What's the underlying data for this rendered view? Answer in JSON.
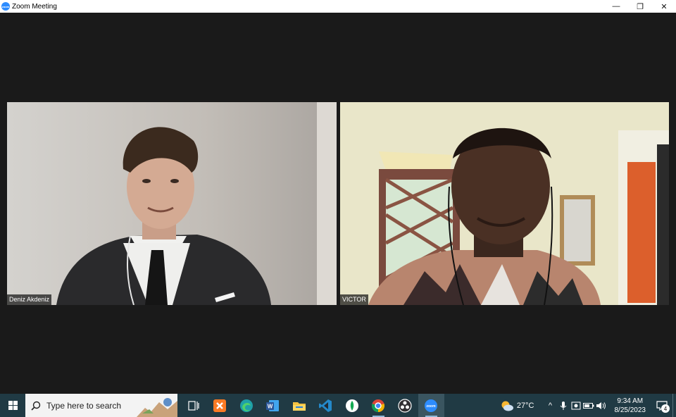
{
  "window": {
    "title": "Zoom Meeting",
    "app_icon_text": "zoom",
    "controls": {
      "minimize": "—",
      "restore": "❐",
      "close": "✕"
    }
  },
  "participants": [
    {
      "name": "Deniz Akdeniz"
    },
    {
      "name": "VICTOR"
    }
  ],
  "taskbar": {
    "search_placeholder": "Type here to search",
    "apps": [
      {
        "icon": "task-view-icon"
      },
      {
        "icon": "xampp-icon",
        "color": "#fb7a24"
      },
      {
        "icon": "edge-icon",
        "color": "#1fa0a8"
      },
      {
        "icon": "word-icon",
        "color": "#2b579a"
      },
      {
        "icon": "file-explorer-icon",
        "color": "#f5c242"
      },
      {
        "icon": "vscode-icon",
        "color": "#2489ca"
      },
      {
        "icon": "mongodb-compass-icon",
        "color": "#13aa52"
      },
      {
        "icon": "chrome-icon",
        "color": "#db4437"
      },
      {
        "icon": "obs-studio-icon",
        "color": "#302e31"
      },
      {
        "icon": "zoom-icon",
        "color": "#2d8cff"
      }
    ],
    "zoom_icon_text": "zoom",
    "weather": {
      "temp": "27°C",
      "icon": "partly-cloudy-icon"
    },
    "tray": {
      "chevron": "^",
      "icons": [
        "microphone-icon",
        "security-icon",
        "battery-icon",
        "volume-icon"
      ]
    },
    "clock": {
      "time": "9:34 AM",
      "date": "8/25/2023"
    },
    "notifications": {
      "count": "4"
    }
  }
}
